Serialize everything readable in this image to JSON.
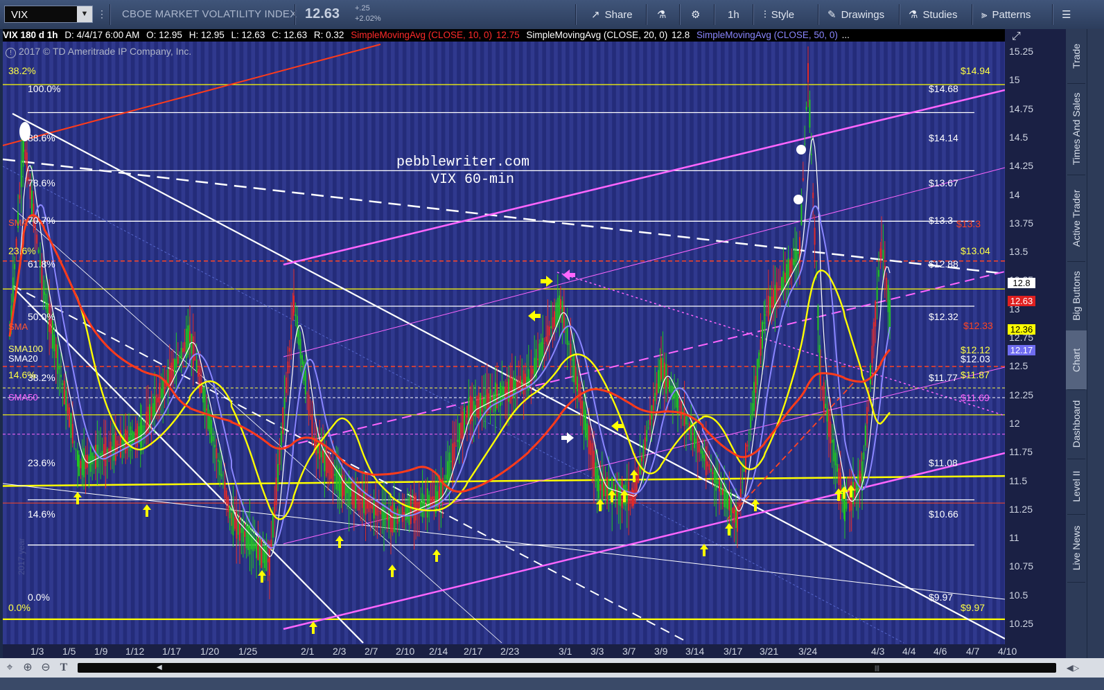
{
  "toolbar": {
    "symbol": "VIX",
    "instrument_name": "CBOE MARKET VOLATILITY INDEX",
    "last_price": "12.63",
    "change_abs": "+.25",
    "change_pct": "+2.02%",
    "share": "Share",
    "timeframe": "1h",
    "style": "Style",
    "drawings": "Drawings",
    "studies": "Studies",
    "patterns": "Patterns"
  },
  "legend": {
    "series": "VIX 180 d 1h",
    "date": "D: 4/4/17 6:00 AM",
    "open": "O: 12.95",
    "high": "H: 12.95",
    "low": "L: 12.63",
    "close": "C: 12.63",
    "range": "R: 0.32",
    "sma10_label": "SimpleMovingAvg (CLOSE, 10, 0)",
    "sma10_value": "12.75",
    "sma20_label": "SimpleMovingAvg (CLOSE, 20, 0)",
    "sma20_value": "12.8",
    "sma50_label": "SimpleMovingAvg (CLOSE, 50, 0)",
    "more": "..."
  },
  "chart": {
    "copyright": "2017 © TD Ameritrade IP Company, Inc.",
    "watermark_line1": "pebblewriter.com",
    "watermark_line2": "VIX 60-min",
    "vertical_watermark": "2017 year",
    "fib_levels": [
      {
        "label": "100.0%",
        "value": "$14.68"
      },
      {
        "label": "88.6%",
        "value": "$14.14"
      },
      {
        "label": "78.6%",
        "value": "$13.67"
      },
      {
        "label": "70.7%",
        "value": "$13.3"
      },
      {
        "label": "61.8%",
        "value": "$12.88"
      },
      {
        "label": "50.0%",
        "value": "$12.32"
      },
      {
        "label": "38.2%",
        "value": "$11.77"
      },
      {
        "label": "23.6%",
        "value": "$11.08"
      },
      {
        "label": "14.6%",
        "value": "$10.66"
      },
      {
        "label": "0.0%",
        "value": "$9.97"
      }
    ],
    "yellow_fib": [
      {
        "label": "38.2%",
        "value": "$14.94"
      },
      {
        "label": "23.6%",
        "value": "$13.04"
      },
      {
        "label": "14.6%",
        "value": "$11.87"
      },
      {
        "label": "0.0%",
        "value": "$9.97"
      }
    ],
    "sma_tags": {
      "sma": "SMA",
      "sma100": "SMA100",
      "sma20": "SMA20",
      "sma50": "SMA50"
    },
    "red_level": "$13.3",
    "red_level2": "$12.33",
    "sma100_value": "$12.12",
    "sma20_level": "$12.03",
    "sma50_level": "$11.69"
  },
  "price_axis": {
    "ticks": [
      "15.25",
      "15",
      "14.75",
      "14.5",
      "14.25",
      "14",
      "13.75",
      "13.5",
      "13.25",
      "13",
      "12.75",
      "12.5",
      "12.25",
      "12",
      "11.75",
      "11.5",
      "11.25",
      "11",
      "10.75",
      "10.5",
      "10.25",
      "10",
      "9.75"
    ],
    "badges": {
      "sma20": "12.8",
      "last": "12.63",
      "sma10": "12.36",
      "sma50": "12.17"
    }
  },
  "date_axis": {
    "labels": [
      "1/3",
      "1/5",
      "1/9",
      "1/12",
      "1/17",
      "1/20",
      "1/25",
      "2/1",
      "2/3",
      "2/7",
      "2/10",
      "2/14",
      "2/17",
      "2/23",
      "3/1",
      "3/3",
      "3/7",
      "3/9",
      "3/14",
      "3/17",
      "3/21",
      "3/24",
      "4/3",
      "4/4",
      "4/6",
      "4/7",
      "4/10"
    ]
  },
  "side_tabs": [
    "Trade",
    "Times And Sales",
    "Active Trader",
    "Big Buttons",
    "Chart",
    "Dashboard",
    "Level II",
    "Live News"
  ],
  "colors": {
    "background": "#242c7a",
    "stripe": "#30398e",
    "fib_white": "#ffffff",
    "fib_yellow": "#ffff00",
    "channel_magenta": "#ff66ff",
    "trend_red": "#ff3b1a",
    "sma10": "#ffff00",
    "sma20": "#ffffff",
    "sma50": "#8a86ff",
    "sma100": "#ff3b1a",
    "candle_up": "#21c521",
    "candle_down": "#e02a2a"
  }
}
